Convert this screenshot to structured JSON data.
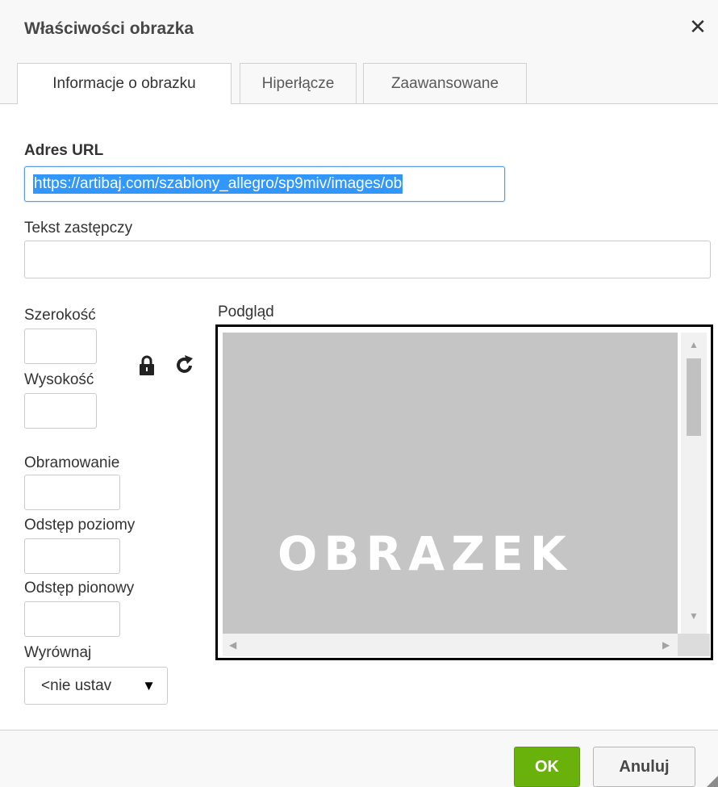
{
  "dialog": {
    "title": "Właściwości obrazka",
    "close_icon": "close-icon"
  },
  "tabs": [
    {
      "label": "Informacje o obrazku",
      "active": true
    },
    {
      "label": "Hiperłącze",
      "active": false
    },
    {
      "label": "Zaawansowane",
      "active": false
    }
  ],
  "form": {
    "url_label": "Adres URL",
    "url_value": "https://artibaj.com/szablony_allegro/sp9miv/images/ob",
    "alt_label": "Tekst zastępczy",
    "alt_value": "",
    "width_label": "Szerokość",
    "width_value": "",
    "height_label": "Wysokość",
    "height_value": "",
    "border_label": "Obramowanie",
    "border_value": "",
    "hspace_label": "Odstęp poziomy",
    "hspace_value": "",
    "vspace_label": "Odstęp pionowy",
    "vspace_value": "",
    "align_label": "Wyrównaj",
    "align_value": "<nie ustav",
    "lock_icon": "lock-icon",
    "reset_icon": "reset-size-icon"
  },
  "preview": {
    "label": "Podgląd",
    "image_text": "OBRAZEK"
  },
  "footer": {
    "ok_label": "OK",
    "cancel_label": "Anuluj"
  },
  "colors": {
    "ok_button": "#69b10b",
    "selection": "#3297fd",
    "focus_border": "#589ae9"
  }
}
